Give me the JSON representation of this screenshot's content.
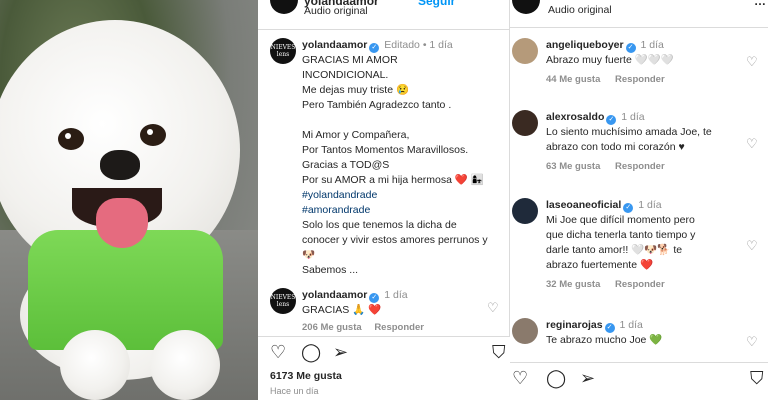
{
  "post": {
    "header": {
      "username": "yolandaamor",
      "follow_label": "Seguir",
      "audio": "Audio original"
    },
    "caption": {
      "username": "yolandaamor",
      "edited": "Editado",
      "age": "1 día",
      "lines": [
        "GRACIAS MI AMOR",
        "INCONDICIONAL.",
        "Me dejas muy triste 😢",
        "Pero También Agradezco tanto .",
        "",
        "Mi Amor y Compañera,",
        "Por Tantos Momentos Maravillosos.",
        "Gracias a TOD@S",
        "Por su AMOR a mi hija hermosa ❤️ 👩‍👧",
        "#yolandandrade",
        "#amorandrade",
        "Solo los que tenemos la dicha de",
        "conocer y vivir estos amores perrunos y",
        "🐶",
        "Sabemos ..."
      ]
    },
    "reply": {
      "username": "yolandaamor",
      "age": "1 día",
      "text": "GRACIAS 🙏 ❤️",
      "likes": "206 Me gusta",
      "reply_label": "Responder"
    },
    "likes": "6173 Me gusta",
    "time": "Hace un día",
    "icons": {
      "like": "heart-icon",
      "comment": "comment-icon",
      "share": "share-icon",
      "save": "bookmark-icon"
    }
  },
  "comments_panel": {
    "header": {
      "audio": "Audio original"
    },
    "comments": [
      {
        "username": "angeliqueboyer",
        "age": "1 día",
        "lines": [
          "Abrazo muy fuerte 🤍🤍🤍"
        ],
        "likes": "44 Me gusta",
        "reply_label": "Responder",
        "avatar_color": "#b59a7a"
      },
      {
        "username": "alexrosaldo",
        "age": "1 día",
        "lines": [
          "Lo siento muchísimo amada Joe, te",
          "abrazo con todo mi corazón ♥"
        ],
        "likes": "63 Me gusta",
        "reply_label": "Responder",
        "avatar_color": "#3a2a22"
      },
      {
        "username": "laseoaneoficial",
        "age": "1 día",
        "lines": [
          "Mi Joe que difícil momento pero",
          "que dicha tenerla tanto tiempo y",
          "darle tanto amor!! 🤍🐶🐕 te",
          "abrazo fuertemente ❤️"
        ],
        "likes": "32 Me gusta",
        "reply_label": "Responder",
        "avatar_color": "#1f2a3a"
      },
      {
        "username": "reginarojas",
        "age": "1 día",
        "lines": [
          "Te abrazo mucho Joe 💚"
        ],
        "likes": "",
        "reply_label": "",
        "avatar_color": "#8a7a6c"
      }
    ]
  }
}
